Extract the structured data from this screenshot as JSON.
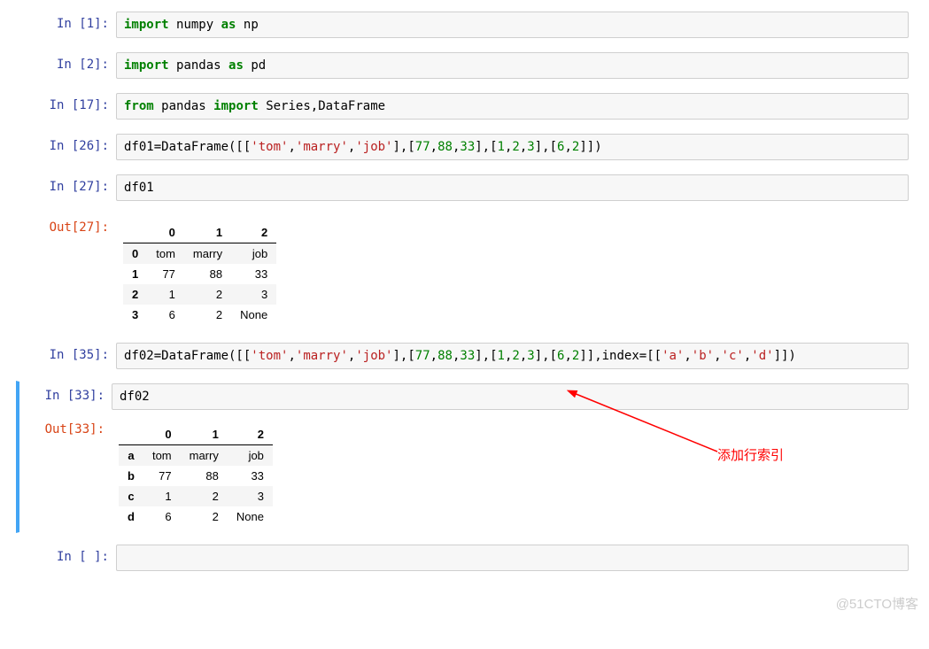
{
  "cells": [
    {
      "in_label": "In  [1]:"
    },
    {
      "in_label": "In  [2]:"
    },
    {
      "in_label": "In [17]:"
    },
    {
      "in_label": "In [26]:"
    },
    {
      "in_label": "In [27]:",
      "code": "df01"
    },
    {
      "out_label": "Out[27]:"
    },
    {
      "in_label": "In [35]:"
    },
    {
      "in_label": "In [33]:",
      "code": "df02"
    },
    {
      "out_label": "Out[33]:"
    },
    {
      "in_label": "In [  ]:"
    }
  ],
  "code1": {
    "kw_import": "import",
    "mod": "numpy",
    "kw_as": "as",
    "alias": "np"
  },
  "code2": {
    "kw_import": "import",
    "mod": "pandas",
    "kw_as": "as",
    "alias": "pd"
  },
  "code3": {
    "kw_from": "from",
    "mod": "pandas",
    "kw_import": "import",
    "names": "Series,DataFrame"
  },
  "code4": {
    "lhs": "df01=DataFrame([[",
    "s1": "'tom'",
    "c1": ",",
    "s2": "'marry'",
    "c2": ",",
    "s3": "'job'",
    "mid1": "],[",
    "n1": "77",
    "c3": ",",
    "n2": "88",
    "c4": ",",
    "n3": "33",
    "mid2": "],[",
    "n4": "1",
    "c5": ",",
    "n5": "2",
    "c6": ",",
    "n6": "3",
    "mid3": "],[",
    "n7": "6",
    "c7": ",",
    "n8": "2",
    "end": "]])"
  },
  "code7": {
    "lhs": "df02=DataFrame([[",
    "s1": "'tom'",
    "c1": ",",
    "s2": "'marry'",
    "c2": ",",
    "s3": "'job'",
    "mid1": "],[",
    "n1": "77",
    "c3": ",",
    "n2": "88",
    "c4": ",",
    "n3": "33",
    "mid2": "],[",
    "n4": "1",
    "c5": ",",
    "n5": "2",
    "c6": ",",
    "n6": "3",
    "mid3": "],[",
    "n7": "6",
    "c7": ",",
    "n8": "2",
    "mid4": "]],index=[[",
    "ia": "'a'",
    "cA": ",",
    "ib": "'b'",
    "cB": ",",
    "ic": "'c'",
    "cC": ",",
    "id": "'d'",
    "end": "]])"
  },
  "table1": {
    "cols": [
      "0",
      "1",
      "2"
    ],
    "rows": [
      {
        "idx": "0",
        "c": [
          "tom",
          "marry",
          "job"
        ]
      },
      {
        "idx": "1",
        "c": [
          "77",
          "88",
          "33"
        ]
      },
      {
        "idx": "2",
        "c": [
          "1",
          "2",
          "3"
        ]
      },
      {
        "idx": "3",
        "c": [
          "6",
          "2",
          "None"
        ]
      }
    ]
  },
  "table2": {
    "cols": [
      "0",
      "1",
      "2"
    ],
    "rows": [
      {
        "idx": "a",
        "c": [
          "tom",
          "marry",
          "job"
        ]
      },
      {
        "idx": "b",
        "c": [
          "77",
          "88",
          "33"
        ]
      },
      {
        "idx": "c",
        "c": [
          "1",
          "2",
          "3"
        ]
      },
      {
        "idx": "d",
        "c": [
          "6",
          "2",
          "None"
        ]
      }
    ]
  },
  "annotation": "添加行索引",
  "watermark": "@51CTO博客"
}
